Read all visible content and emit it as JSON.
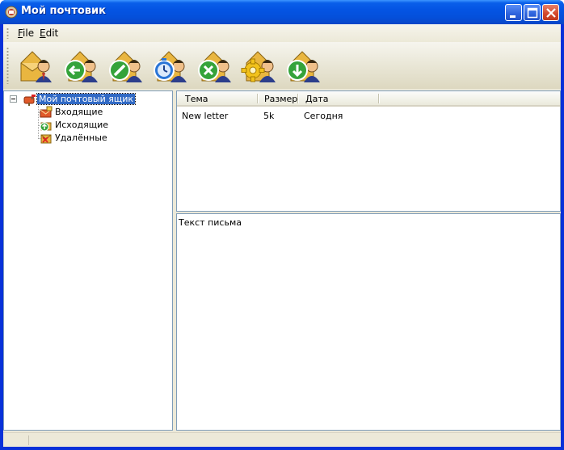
{
  "window": {
    "title": "Мой почтовик",
    "title_icon": "mail-app-icon",
    "controls": [
      "minimize-icon",
      "maximize-icon",
      "close-icon"
    ]
  },
  "menu": {
    "items": [
      {
        "underline": "F",
        "rest": "ile"
      },
      {
        "underline": "E",
        "rest": "dit"
      }
    ]
  },
  "toolbar": {
    "buttons": [
      {
        "icon": "open-envelope-user-icon"
      },
      {
        "icon": "reply-back-arrow-icon"
      },
      {
        "icon": "compose-pencil-icon"
      },
      {
        "icon": "schedule-clock-icon"
      },
      {
        "icon": "delete-x-icon"
      },
      {
        "icon": "settings-gear-icon"
      },
      {
        "icon": "download-arrow-icon"
      }
    ]
  },
  "tree": {
    "root": {
      "label": "Мой почтовый ящик",
      "icon": "mailbox-icon",
      "expanded": true,
      "selected": true
    },
    "children": [
      {
        "label": "Входящие",
        "icon": "inbox-icon"
      },
      {
        "label": "Исходящие",
        "icon": "outbox-icon"
      },
      {
        "label": "Удалённые",
        "icon": "deleted-icon"
      }
    ]
  },
  "list": {
    "columns": [
      "Тема",
      "Размер",
      "Дата"
    ],
    "rows": [
      {
        "subject": "New letter",
        "size": "5k",
        "date": "Сегодня"
      }
    ]
  },
  "preview": {
    "text": "Текст письма"
  },
  "colors": {
    "titlebar": "#0454e3",
    "selection": "#316ac5",
    "face": "#ece9d8",
    "pane_border": "#7f9db9"
  }
}
